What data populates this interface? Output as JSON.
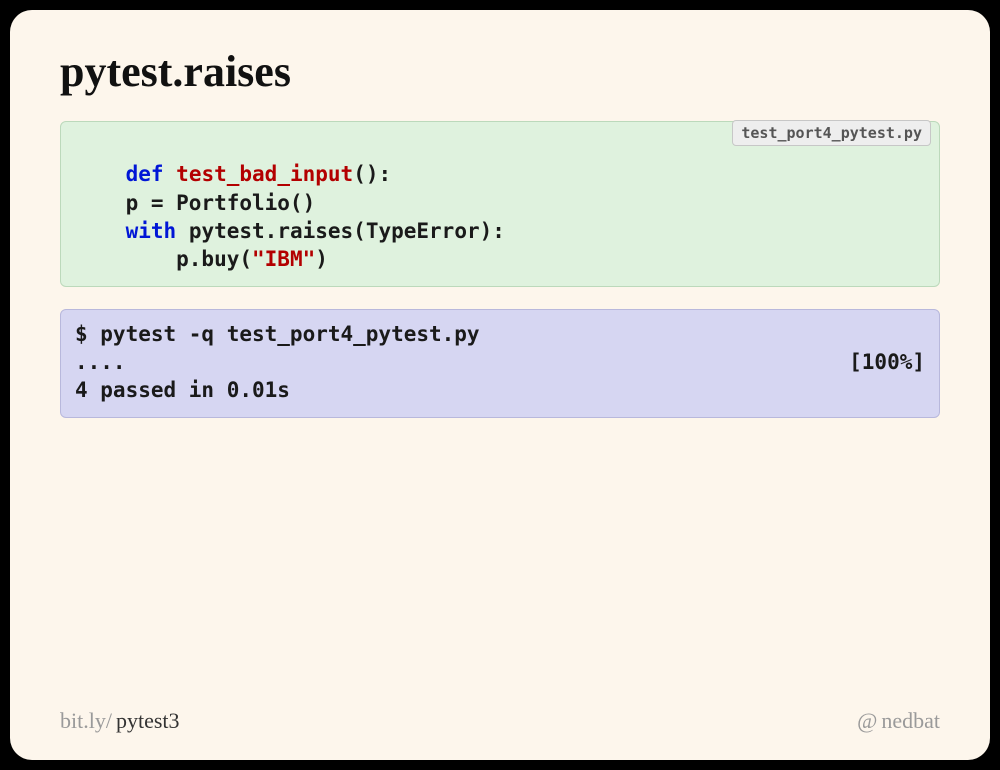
{
  "title": "pytest.raises",
  "codeblock_python": {
    "filename": "test_port4_pytest.py",
    "kw_def": "def",
    "fn_name": "test_bad_input",
    "fn_paren": "():",
    "line2": "    p = Portfolio()",
    "kw_with": "with",
    "raises_call": "pytest.raises(TypeError):",
    "buy_prefix": "        p.buy(",
    "buy_str": "\"IBM\"",
    "buy_suffix": ")"
  },
  "codeblock_shell": {
    "cmd": "$ pytest -q test_port4_pytest.py",
    "dots": "....",
    "percent": "[100%]",
    "summary": "4 passed in 0.01s"
  },
  "footer": {
    "url_prefix": "bit.ly/",
    "url_slug": "pytest3",
    "handle_at": "@",
    "handle_name": "nedbat"
  }
}
